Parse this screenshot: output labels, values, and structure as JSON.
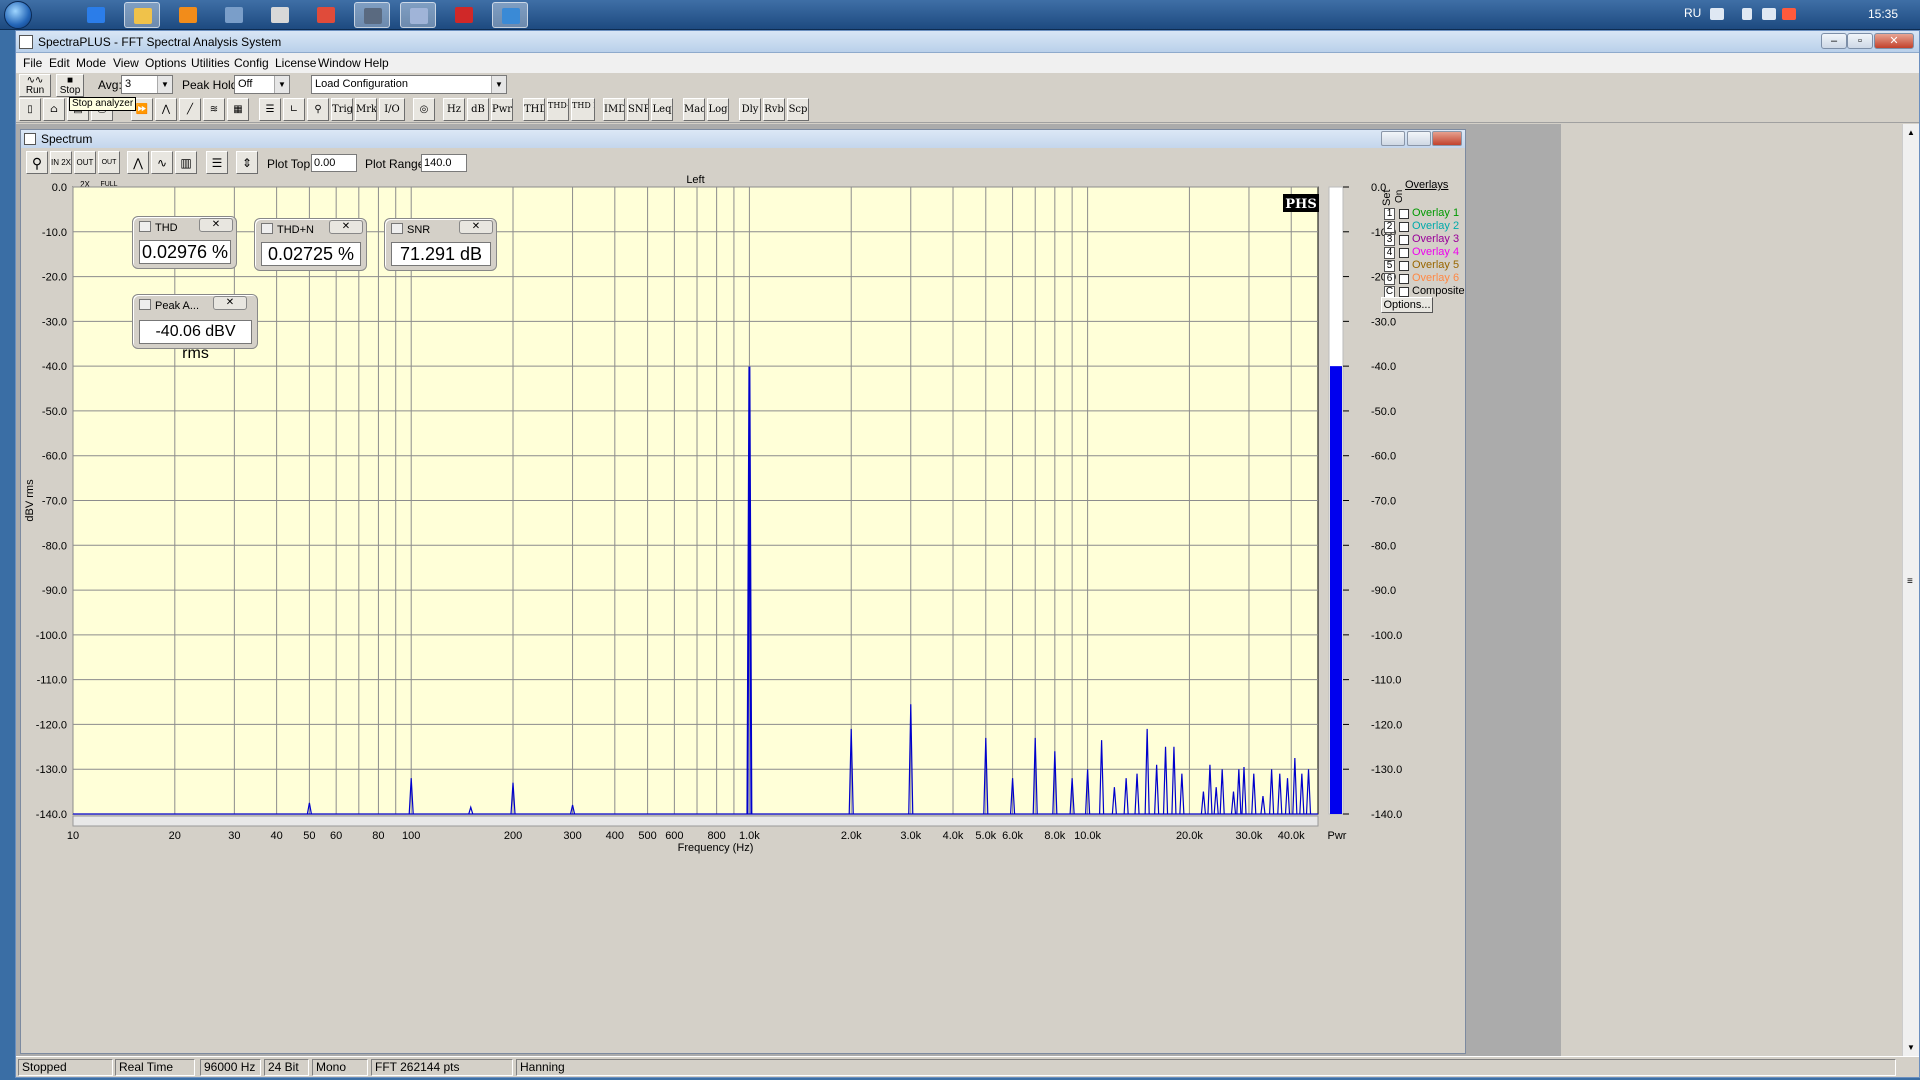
{
  "taskbar": {
    "lang": "RU",
    "time": "15:35",
    "pinned": [
      "ie-icon",
      "explorer-icon",
      "media-player-icon",
      "app-icon-4",
      "app-icon-5",
      "chrome-icon",
      "app-icon-7",
      "spectraplus-icon",
      "app-icon-9",
      "app-icon-10"
    ]
  },
  "window": {
    "title": "SpectraPLUS - FFT Spectral Analysis System"
  },
  "menu": [
    "File",
    "Edit",
    "Mode",
    "View",
    "Options",
    "Utilities",
    "Config",
    "License",
    "Window",
    "Help"
  ],
  "toolbar": {
    "run_label": "Run",
    "stop_label": "Stop",
    "avg_label": "Avg:",
    "avg_value": "3",
    "peak_hold_label": "Peak Hold:",
    "peak_hold_value": "Off",
    "config_value": "Load Configuration",
    "tooltip": "Stop analyzer",
    "buttons": [
      "Trig",
      "Mrk",
      "I/O",
      "Hz",
      "dB",
      "Pwr",
      "THD",
      "THD+N",
      "THD Freq",
      "IMD",
      "SNR",
      "Leq",
      "Mac",
      "Log",
      "Dly",
      "Rvb",
      "Scp"
    ]
  },
  "spectrum": {
    "title": "Spectrum",
    "zoom_labels": [
      "IN 2X",
      "OUT 2X",
      "OUT FULL"
    ],
    "plot_top_label": "Plot Top:",
    "plot_top_value": "0.00",
    "plot_range_label": "Plot Range:",
    "plot_range_value": "140.0",
    "channel_label": "Left",
    "logo": "PHS",
    "power_label": "Pwr",
    "power_level_dbv": -40.0
  },
  "readouts": [
    {
      "name": "THD",
      "value": "0.02976 %"
    },
    {
      "name": "THD+N",
      "value": "0.02725 %"
    },
    {
      "name": "SNR",
      "value": "71.291 dB"
    },
    {
      "name": "Peak A...",
      "value": "-40.06 dBV rms"
    }
  ],
  "overlays": {
    "title": "Overlays",
    "set_label": "Set",
    "on_label": "On",
    "items": [
      {
        "num": "1",
        "label": "Overlay 1",
        "color": "#009900"
      },
      {
        "num": "2",
        "label": "Overlay 2",
        "color": "#00aaaa"
      },
      {
        "num": "3",
        "label": "Overlay 3",
        "color": "#990099"
      },
      {
        "num": "4",
        "label": "Overlay 4",
        "color": "#ee00ee"
      },
      {
        "num": "5",
        "label": "Overlay 5",
        "color": "#996600"
      },
      {
        "num": "6",
        "label": "Overlay 6",
        "color": "#ff8844"
      },
      {
        "num": "C",
        "label": "Composite",
        "color": "#000000"
      }
    ],
    "options_label": "Options..."
  },
  "status": [
    "Stopped",
    "Real Time",
    "96000 Hz",
    "24 Bit",
    "Mono",
    "FFT 262144 pts",
    "Hanning"
  ],
  "chart_data": {
    "type": "line",
    "title": "",
    "xlabel": "Frequency (Hz)",
    "ylabel": "dBV rms",
    "x_scale": "log",
    "xlim": [
      10,
      48000
    ],
    "ylim": [
      -140,
      0
    ],
    "background": "#ffffd8",
    "line_color": "#0000cc",
    "grid": true,
    "yticks": [
      "0.0",
      "-10.0",
      "-20.0",
      "-30.0",
      "-40.0",
      "-50.0",
      "-60.0",
      "-70.0",
      "-80.0",
      "-90.0",
      "-100.0",
      "-110.0",
      "-120.0",
      "-130.0",
      "-140.0"
    ],
    "xticks": [
      {
        "v": 10,
        "t": "10"
      },
      {
        "v": 20,
        "t": "20"
      },
      {
        "v": 30,
        "t": "30"
      },
      {
        "v": 40,
        "t": "40"
      },
      {
        "v": 50,
        "t": "50"
      },
      {
        "v": 60,
        "t": "60"
      },
      {
        "v": 80,
        "t": "80"
      },
      {
        "v": 100,
        "t": "100"
      },
      {
        "v": 200,
        "t": "200"
      },
      {
        "v": 300,
        "t": "300"
      },
      {
        "v": 400,
        "t": "400"
      },
      {
        "v": 500,
        "t": "500"
      },
      {
        "v": 600,
        "t": "600"
      },
      {
        "v": 800,
        "t": "800"
      },
      {
        "v": 1000,
        "t": "1.0k"
      },
      {
        "v": 2000,
        "t": "2.0k"
      },
      {
        "v": 3000,
        "t": "3.0k"
      },
      {
        "v": 4000,
        "t": "4.0k"
      },
      {
        "v": 5000,
        "t": "5.0k"
      },
      {
        "v": 6000,
        "t": "6.0k"
      },
      {
        "v": 8000,
        "t": "8.0k"
      },
      {
        "v": 10000,
        "t": "10.0k"
      },
      {
        "v": 20000,
        "t": "20.0k"
      },
      {
        "v": 30000,
        "t": "30.0k"
      },
      {
        "v": 40000,
        "t": "40.0k"
      }
    ],
    "noise_floor": -140,
    "peaks": [
      {
        "f": 50,
        "db": -137.5
      },
      {
        "f": 100,
        "db": -132
      },
      {
        "f": 150,
        "db": -138.5
      },
      {
        "f": 200,
        "db": -133
      },
      {
        "f": 300,
        "db": -138
      },
      {
        "f": 1000,
        "db": -40.1
      },
      {
        "f": 2000,
        "db": -121
      },
      {
        "f": 3000,
        "db": -115.5
      },
      {
        "f": 5000,
        "db": -123
      },
      {
        "f": 6000,
        "db": -132
      },
      {
        "f": 7000,
        "db": -123
      },
      {
        "f": 8000,
        "db": -126
      },
      {
        "f": 9000,
        "db": -132
      },
      {
        "f": 10000,
        "db": -130
      },
      {
        "f": 11000,
        "db": -123.5
      },
      {
        "f": 12000,
        "db": -134
      },
      {
        "f": 13000,
        "db": -132
      },
      {
        "f": 14000,
        "db": -131
      },
      {
        "f": 15000,
        "db": -121
      },
      {
        "f": 16000,
        "db": -129
      },
      {
        "f": 17000,
        "db": -125
      },
      {
        "f": 18000,
        "db": -125
      },
      {
        "f": 19000,
        "db": -131
      },
      {
        "f": 22000,
        "db": -135
      },
      {
        "f": 23000,
        "db": -129
      },
      {
        "f": 24000,
        "db": -134
      },
      {
        "f": 25000,
        "db": -130
      },
      {
        "f": 27000,
        "db": -135
      },
      {
        "f": 28000,
        "db": -130
      },
      {
        "f": 29000,
        "db": -129.5
      },
      {
        "f": 31000,
        "db": -131
      },
      {
        "f": 33000,
        "db": -136
      },
      {
        "f": 35000,
        "db": -130
      },
      {
        "f": 37000,
        "db": -131
      },
      {
        "f": 39000,
        "db": -132
      },
      {
        "f": 41000,
        "db": -127.5
      },
      {
        "f": 43000,
        "db": -131
      },
      {
        "f": 45000,
        "db": -130
      }
    ]
  }
}
